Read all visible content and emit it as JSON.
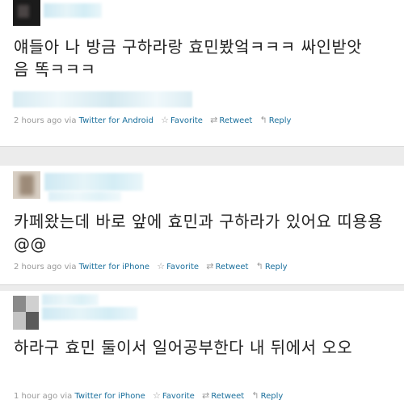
{
  "tweets": [
    {
      "text": "얘들아 나 방금 구하라랑 효민봤엌ㅋㅋㅋ 싸인받앗음 똑ㅋㅋㅋ",
      "time": "2 hours ago",
      "via": "via",
      "source": "Twitter for Android",
      "favorite": "Favorite",
      "retweet": "Retweet",
      "reply": "Reply"
    },
    {
      "text": "카페왔는데 바로 앞에 효민과 구하라가 있어요 띠용용@@",
      "time": "2 hours ago",
      "via": "via",
      "source": "Twitter for iPhone",
      "favorite": "Favorite",
      "retweet": "Retweet",
      "reply": "Reply"
    },
    {
      "text": "하라구 효민 둘이서 일어공부한다 내 뒤에서 오오",
      "time": "1 hour ago",
      "via": "via",
      "source": "Twitter for iPhone",
      "favorite": "Favorite",
      "retweet": "Retweet",
      "reply": "Reply"
    }
  ],
  "icons": {
    "favorite": "star-icon",
    "retweet": "retweet-icon",
    "reply": "reply-icon"
  },
  "colors": {
    "link": "#1a6f9c",
    "meta": "#999999",
    "text": "#222222",
    "background": "#ececec"
  }
}
